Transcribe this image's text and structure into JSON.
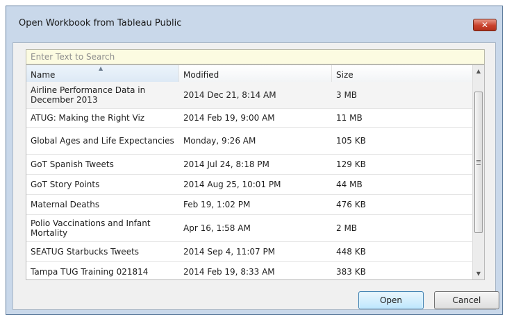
{
  "window": {
    "title": "Open Workbook from Tableau Public",
    "close_icon": "close-icon"
  },
  "search": {
    "placeholder": "Enter Text to Search",
    "value": ""
  },
  "table": {
    "columns": [
      "Name",
      "Modified",
      "Size"
    ],
    "sorted_column": "Name",
    "sort_direction": "ascending",
    "rows": [
      {
        "name": "Airline Performance Data in December 2013",
        "modified": "2014 Dec 21, 8:14 AM",
        "size": "3 MB"
      },
      {
        "name": "ATUG: Making the Right Viz",
        "modified": "2014 Feb 19, 9:00 AM",
        "size": "11 MB"
      },
      {
        "name": "Global Ages and Life Expectancies",
        "modified": "Monday, 9:26 AM",
        "size": "105 KB"
      },
      {
        "name": "GoT Spanish Tweets",
        "modified": "2014 Jul 24, 8:18 PM",
        "size": "129 KB"
      },
      {
        "name": "GoT Story Points",
        "modified": "2014 Aug 25, 10:01 PM",
        "size": "44 MB"
      },
      {
        "name": "Maternal Deaths",
        "modified": "Feb 19, 1:02 PM",
        "size": "476 KB"
      },
      {
        "name": "Polio Vaccinations and Infant Mortality",
        "modified": "Apr 16, 1:58 AM",
        "size": "2 MB"
      },
      {
        "name": "SEATUG Starbucks Tweets",
        "modified": "2014 Sep 4, 11:07 PM",
        "size": "448 KB"
      },
      {
        "name": "Tampa TUG Training 021814",
        "modified": "2014 Feb 19, 8:33 AM",
        "size": "383 KB"
      }
    ],
    "selected_row": 0,
    "scroll_position": 0.3
  },
  "buttons": {
    "open": "Open",
    "cancel": "Cancel"
  },
  "colors": {
    "frame": "#c9d8ea",
    "close_button": "#c9412c",
    "search_background": "#fcfbe1",
    "default_button": "#bee6fd"
  }
}
